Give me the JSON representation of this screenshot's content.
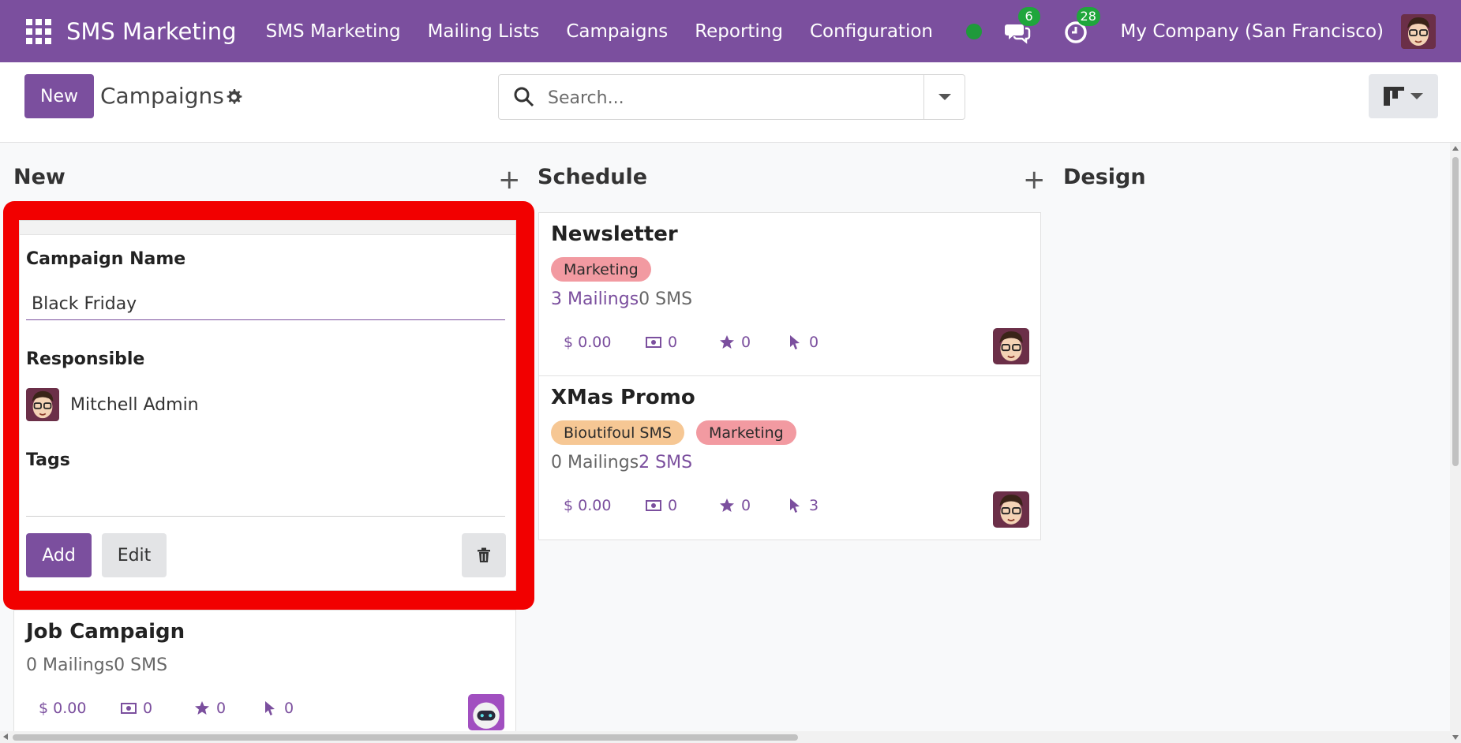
{
  "navbar": {
    "brand": "SMS Marketing",
    "menu": [
      "SMS Marketing",
      "Mailing Lists",
      "Campaigns",
      "Reporting",
      "Configuration"
    ],
    "messages_count": "6",
    "activities_count": "28",
    "company": "My Company (San Francisco)"
  },
  "control": {
    "new_label": "New",
    "breadcrumb": "Campaigns",
    "search_placeholder": "Search..."
  },
  "columns": {
    "new": "New",
    "schedule": "Schedule",
    "design": "Design"
  },
  "quick_create": {
    "name_label": "Campaign Name",
    "name_value": "Black Friday",
    "responsible_label": "Responsible",
    "responsible_value": "Mitchell Admin",
    "tags_label": "Tags",
    "add_label": "Add",
    "edit_label": "Edit"
  },
  "cards": {
    "newsletter": {
      "title": "Newsletter",
      "tags": [
        "Marketing"
      ],
      "mailings": "3 Mailings",
      "sms": "0 SMS",
      "revenue": "$ 0.00",
      "quotations": "0",
      "opportunities": "0",
      "clicks": "0"
    },
    "xmas": {
      "title": "XMas Promo",
      "tags": [
        "Bioutifoul SMS",
        "Marketing"
      ],
      "mailings": "0 Mailings",
      "sms": "2 SMS",
      "revenue": "$ 0.00",
      "quotations": "0",
      "opportunities": "0",
      "clicks": "3"
    },
    "job": {
      "title": "Job Campaign",
      "mailings": "0 Mailings",
      "sms": "0 SMS",
      "revenue": "$ 0.00",
      "quotations": "0",
      "opportunities": "0",
      "clicks": "0"
    }
  },
  "colors": {
    "primary": "#7b4f9e",
    "highlight": "#f20000",
    "badge": "#1fa63c"
  }
}
